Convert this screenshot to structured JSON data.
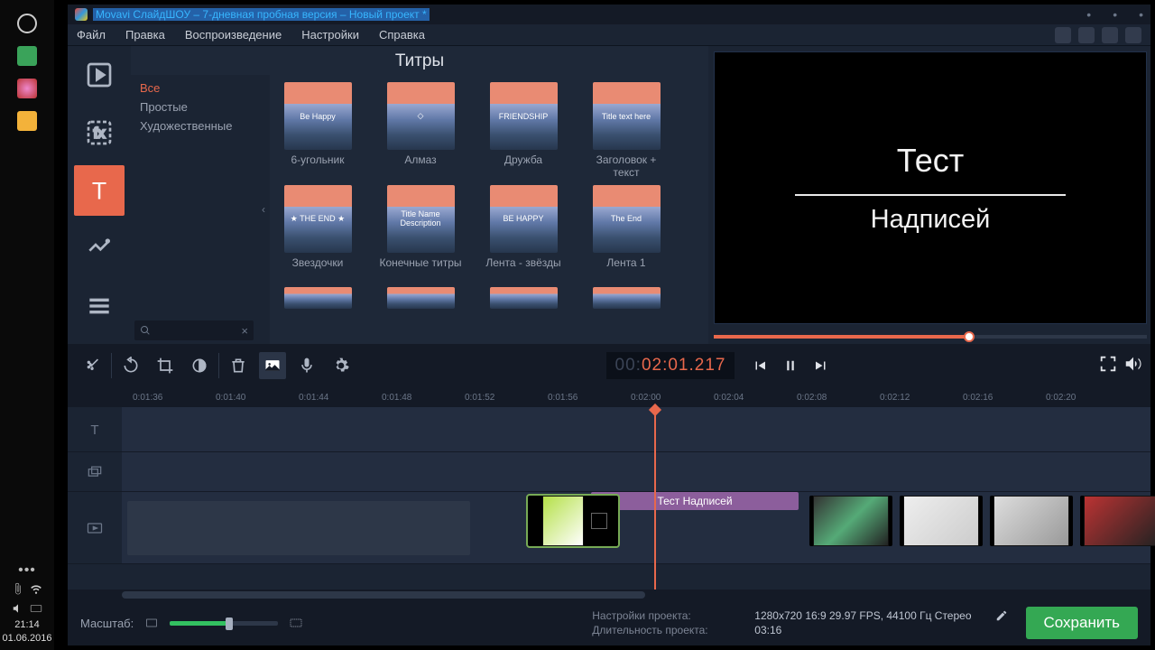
{
  "os": {
    "dock_icons": [
      "circle",
      "image",
      "shield",
      "folder"
    ],
    "dots": "•••",
    "clock_time": "21:14",
    "clock_date": "01.06.2016"
  },
  "window": {
    "title": "Movavi СлайдШОУ – 7-дневная пробная версия – Новый проект *"
  },
  "menu": {
    "items": [
      "Файл",
      "Правка",
      "Воспроизведение",
      "Настройки",
      "Справка"
    ]
  },
  "sidebar": {
    "tools": [
      {
        "name": "media",
        "active": false
      },
      {
        "name": "filters",
        "active": false
      },
      {
        "name": "titles",
        "active": true
      },
      {
        "name": "transitions",
        "active": false
      },
      {
        "name": "more",
        "active": false
      }
    ]
  },
  "browser": {
    "header": "Титры",
    "categories": [
      {
        "label": "Все",
        "selected": true
      },
      {
        "label": "Простые",
        "selected": false
      },
      {
        "label": "Художественные",
        "selected": false
      }
    ],
    "items": [
      {
        "label": "6-угольник",
        "overlay": "Be Happy"
      },
      {
        "label": "Алмаз",
        "overlay": "◇"
      },
      {
        "label": "Дружба",
        "overlay": "FRIENDSHIP"
      },
      {
        "label": "Заголовок + текст",
        "overlay": "Title text here"
      },
      {
        "label": "Звездочки",
        "overlay": "★ THE END ★"
      },
      {
        "label": "Конечные титры",
        "overlay": "Title\nName Description"
      },
      {
        "label": "Лента - звёзды",
        "overlay": "BE HAPPY"
      },
      {
        "label": "Лента 1",
        "overlay": "The End"
      },
      {
        "label": "",
        "overlay": ""
      },
      {
        "label": "",
        "overlay": ""
      },
      {
        "label": "",
        "overlay": ""
      },
      {
        "label": "",
        "overlay": ""
      }
    ]
  },
  "preview": {
    "line1": "Тест",
    "line2": "Надписей",
    "timecode_dim": "00:",
    "timecode_hot": "02:01.217"
  },
  "timeline": {
    "ticks": [
      "0:01:36",
      "0:01:40",
      "0:01:44",
      "0:01:48",
      "0:01:52",
      "0:01:56",
      "0:02:00",
      "0:02:04",
      "0:02:08",
      "0:02:12",
      "0:02:16",
      "0:02:20"
    ],
    "title_clip": "Тест Надписей",
    "playhead_pct": 54,
    "zoom_label": "Масштаб:"
  },
  "project": {
    "settings_label": "Настройки проекта:",
    "settings_value": "1280x720 16:9 29.97 FPS, 44100 Гц Стерео",
    "duration_label": "Длительность проекта:",
    "duration_value": "03:16",
    "save": "Сохранить"
  }
}
